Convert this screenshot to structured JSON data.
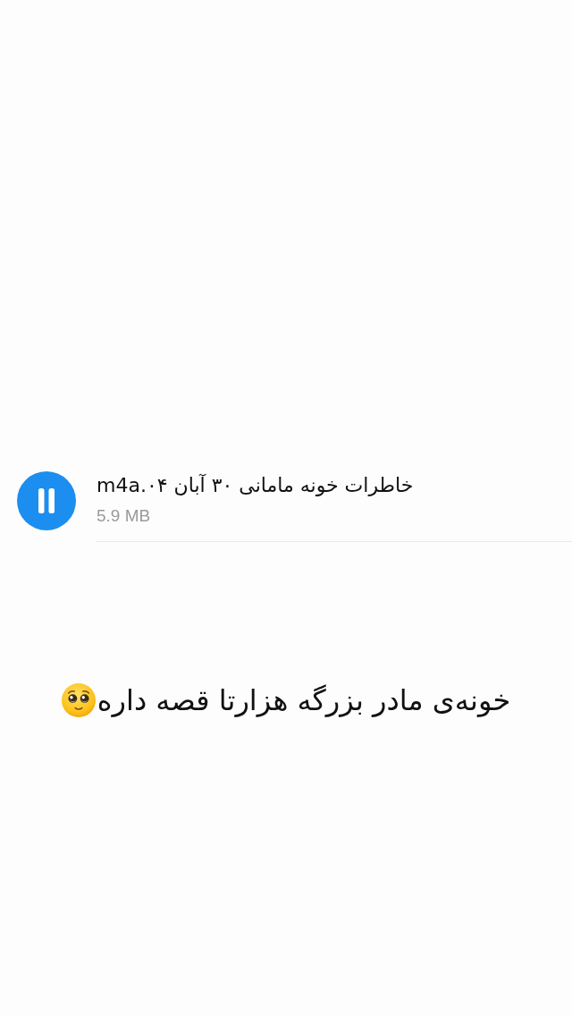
{
  "audio_file": {
    "playing": true,
    "name": "خاطرات خونه مامانی ۳۰ آبان ۰۴.m4a",
    "size": "5.9 MB"
  },
  "caption": {
    "text": "خونه‌ی مادر بزرگه هزارتا قصه داره"
  }
}
